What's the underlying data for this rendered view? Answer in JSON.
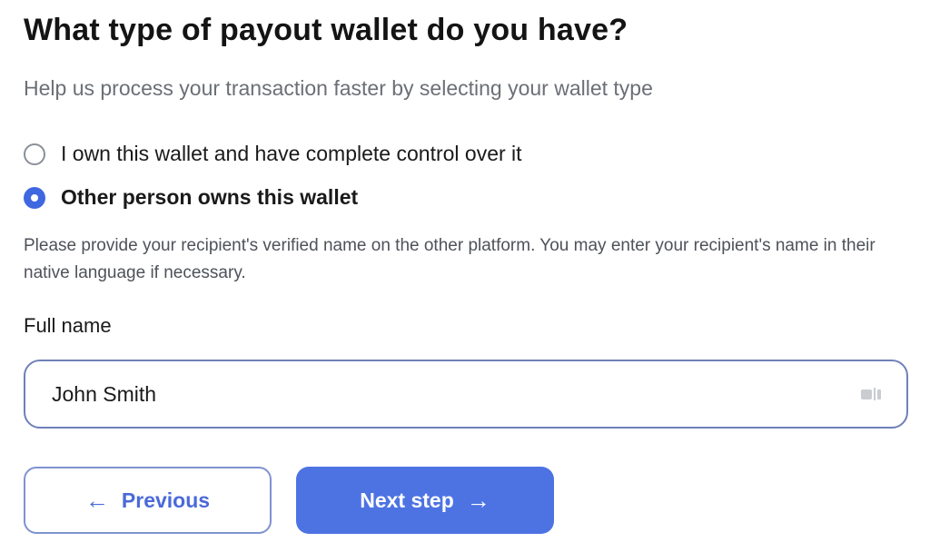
{
  "header": {
    "title": "What type of payout wallet do you have?",
    "subtitle": "Help us process your transaction faster by selecting your wallet type"
  },
  "wallet_options": [
    {
      "label": "I own this wallet and have complete control over it",
      "selected": false
    },
    {
      "label": "Other person owns this wallet",
      "selected": true
    }
  ],
  "help_text": "Please provide your recipient's verified name on the other platform. You may enter your recipient's name in their native language if necessary.",
  "full_name": {
    "label": "Full name",
    "value": "John Smith",
    "autofill_icon": "autofill-icon"
  },
  "buttons": {
    "previous_arrow": "←",
    "previous_label": "Previous",
    "next_label": "Next step",
    "next_arrow": "→"
  },
  "colors": {
    "accent": "#4d73e3",
    "radio_selected": "#3f67e0",
    "input_border": "#6f80b8",
    "muted_text": "#6b6f76"
  }
}
